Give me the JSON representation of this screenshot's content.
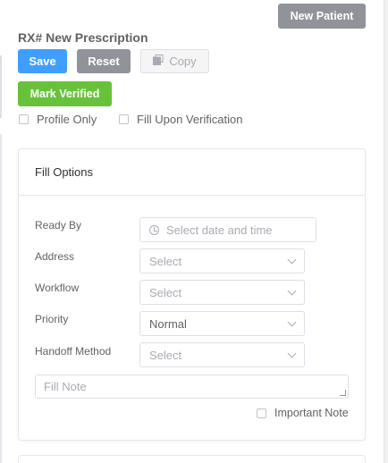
{
  "header": {
    "new_patient_label": "New Patient",
    "title": "RX# New Prescription"
  },
  "toolbar": {
    "save_label": "Save",
    "reset_label": "Reset",
    "copy_label": "Copy",
    "mark_verified_label": "Mark Verified"
  },
  "options": {
    "profile_only_label": "Profile Only",
    "profile_only_checked": false,
    "fill_upon_verification_label": "Fill Upon Verification",
    "fill_upon_verification_checked": false
  },
  "fill_options": {
    "title": "Fill Options",
    "ready_by": {
      "label": "Ready By",
      "placeholder": "Select date and time"
    },
    "address": {
      "label": "Address",
      "placeholder": "Select"
    },
    "workflow": {
      "label": "Workflow",
      "placeholder": "Select"
    },
    "priority": {
      "label": "Priority",
      "value": "Normal"
    },
    "handoff_method": {
      "label": "Handoff Method",
      "placeholder": "Select"
    },
    "fill_note": {
      "placeholder": "Fill Note"
    },
    "important_note": {
      "label": "Important Note",
      "checked": false
    }
  }
}
